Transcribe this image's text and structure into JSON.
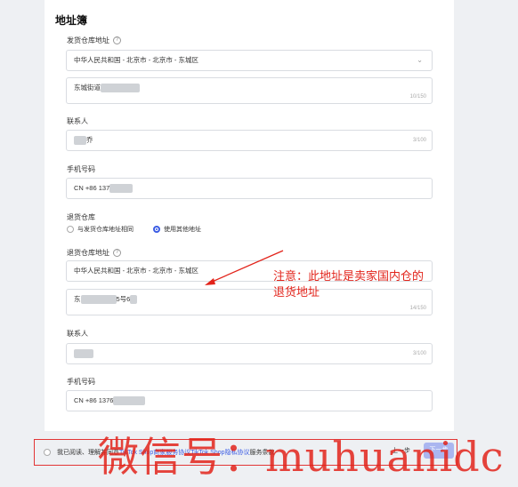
{
  "section_title": "地址簿",
  "shipping": {
    "warehouse_label": "发货仓库地址",
    "region_value": "中华人民共和国 - 北京市 - 北京市 - 东城区",
    "street_value": "东城街道",
    "street_counter": "10/150",
    "contact_label": "联系人",
    "contact_value": "乔",
    "contact_counter": "3/100",
    "phone_label": "手机号码",
    "phone_value": "CN +86  137"
  },
  "returns": {
    "warehouse_label": "退货仓库",
    "option_same": "与发货仓库地址相同",
    "option_other": "使用其他地址",
    "address_label": "退货仓库地址",
    "region_value": "中华人民共和国 - 北京市 - 北京市 - 东城区",
    "street_value_prefix": "东",
    "street_value_mid": "5号6",
    "street_counter": "14/150",
    "contact_label": "联系人",
    "contact_counter": "3/100",
    "phone_label": "手机号码",
    "phone_value": "CN +86  1376"
  },
  "annotation": {
    "note_line1": "注意：此地址是卖家国内仓的",
    "note_line2": "退货地址"
  },
  "footer": {
    "agree_prefix": "我已阅读、理解并同意",
    "link1": "TikTok Shop商家服务协议",
    "link2": "TikTok Shop隐私协议",
    "agree_suffix": "服务条款",
    "cancel_label": "上一步",
    "next_label": "下一步"
  },
  "watermark": "微信号：muhuanidc",
  "colors": {
    "accent": "#3b5ce4",
    "annotation": "#e2231a"
  }
}
